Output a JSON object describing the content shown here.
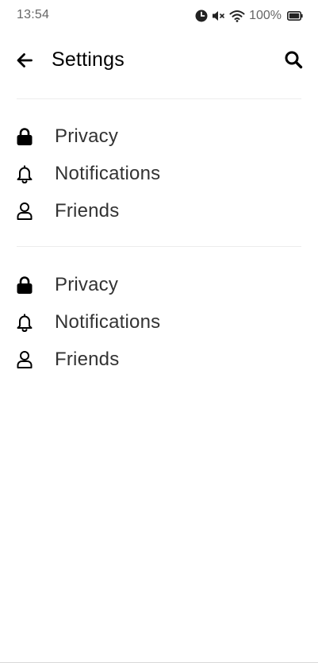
{
  "status_bar": {
    "time": "13:54",
    "battery_percent": "100%",
    "icons": [
      "alarm-icon",
      "mute-icon",
      "wifi-icon",
      "battery-icon"
    ]
  },
  "header": {
    "title": "Settings",
    "back_icon": "arrow-left-icon",
    "search_icon": "search-icon"
  },
  "sections": [
    {
      "items": [
        {
          "label": "Privacy",
          "icon": "lock-icon"
        },
        {
          "label": "Notifications",
          "icon": "bell-icon"
        },
        {
          "label": "Friends",
          "icon": "person-icon"
        }
      ]
    },
    {
      "items": [
        {
          "label": "Privacy",
          "icon": "lock-icon"
        },
        {
          "label": "Notifications",
          "icon": "bell-icon"
        },
        {
          "label": "Friends",
          "icon": "person-icon"
        }
      ]
    }
  ]
}
